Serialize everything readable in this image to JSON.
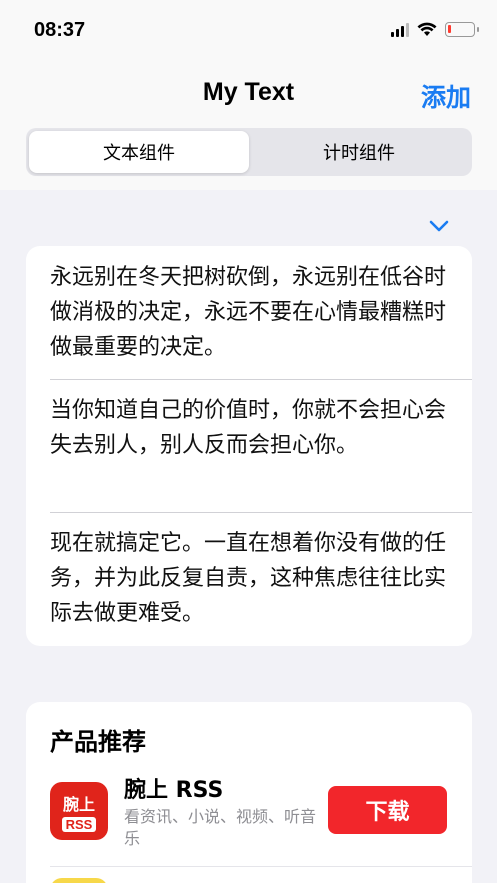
{
  "status_bar": {
    "time": "08:37"
  },
  "nav": {
    "title": "My Text",
    "add_label": "添加"
  },
  "segments": [
    {
      "label": "文本组件",
      "active": true
    },
    {
      "label": "计时组件",
      "active": false
    }
  ],
  "quotes": [
    "永远别在冬天把树砍倒，永远别在低谷时做消极的决定，永远不要在心情最糟糕时做最重要的决定。",
    "当你知道自己的价值时，你就不会担心会失去别人，别人反而会担心你。",
    "现在就搞定它。一直在想着你没有做的任务，并为此反复自责，这种焦虑往往比实际去做更难受。"
  ],
  "products": {
    "heading": "产品推荐",
    "items": [
      {
        "icon_line1": "腕上",
        "icon_line2": "RSS",
        "name": "腕上 RSS",
        "description": "看资讯、小说、视频、听音乐",
        "button_label": "下载"
      }
    ]
  },
  "colors": {
    "accent": "#1a7cf2",
    "download": "#f2262b",
    "battery_low": "#ff3b30"
  },
  "icons": {
    "expand": "chevron-down-icon",
    "wifi": "wifi-icon",
    "signal": "signal-icon",
    "battery": "battery-icon"
  }
}
